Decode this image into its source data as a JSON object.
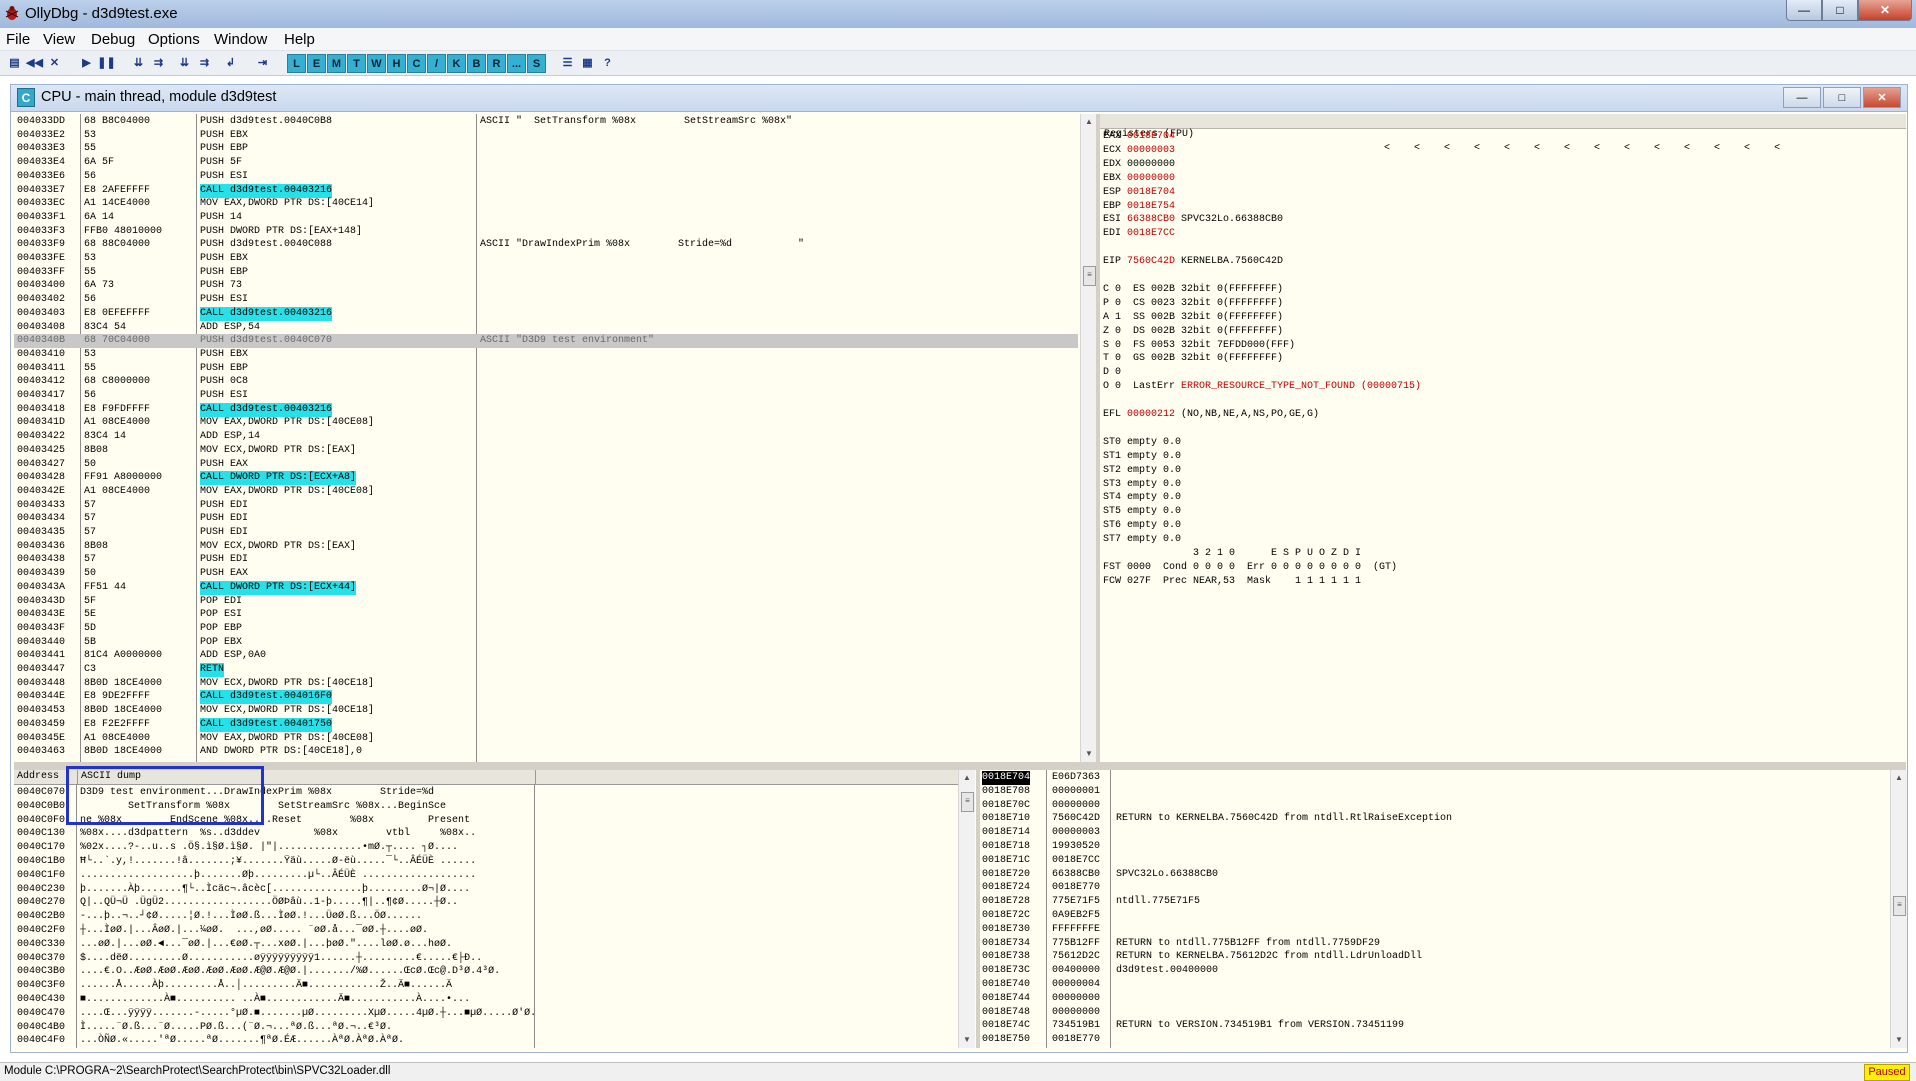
{
  "window": {
    "title": "OllyDbg - d3d9test.exe",
    "minimize": "—",
    "maximize": "□",
    "close": "✕"
  },
  "menu": [
    "File",
    "View",
    "Debug",
    "Options",
    "Window",
    "Help"
  ],
  "toolbar": {
    "letters": [
      "L",
      "E",
      "M",
      "T",
      "W",
      "H",
      "C",
      "/",
      "K",
      "B",
      "R",
      "...",
      "S"
    ],
    "icons": [
      "open-icon",
      "rewind-icon",
      "close-icon",
      "run-icon",
      "pause-icon",
      "step-into-icon",
      "step-over-icon",
      "trace-into-icon",
      "trace-over-icon",
      "execute-till-return-icon",
      "goto-icon"
    ],
    "help": "?"
  },
  "cpu_window": {
    "badge": "C",
    "title": "CPU - main thread, module d3d9test"
  },
  "disasm": {
    "rows": [
      {
        "addr": "004033DD",
        "hex": "68 B8C04000",
        "asm": "PUSH d3d9test.0040C0B8",
        "cmt": "ASCII \"  SetTransform %08x        SetStreamSrc %08x\""
      },
      {
        "addr": "004033E2",
        "hex": "53",
        "asm": "PUSH EBX",
        "cmt": ""
      },
      {
        "addr": "004033E3",
        "hex": "55",
        "asm": "PUSH EBP",
        "cmt": ""
      },
      {
        "addr": "004033E4",
        "hex": "6A 5F",
        "asm": "PUSH 5F",
        "cmt": ""
      },
      {
        "addr": "004033E6",
        "hex": "56",
        "asm": "PUSH ESI",
        "cmt": ""
      },
      {
        "addr": "004033E7",
        "hex": "E8 2AFEFFFF",
        "asm": "CALL d3d9test.00403216",
        "cmt": "",
        "call": true
      },
      {
        "addr": "004033EC",
        "hex": "A1 14CE4000",
        "asm": "MOV EAX,DWORD PTR DS:[40CE14]",
        "cmt": ""
      },
      {
        "addr": "004033F1",
        "hex": "6A 14",
        "asm": "PUSH 14",
        "cmt": ""
      },
      {
        "addr": "004033F3",
        "hex": "FFB0 48010000",
        "asm": "PUSH DWORD PTR DS:[EAX+148]",
        "cmt": ""
      },
      {
        "addr": "004033F9",
        "hex": "68 88C04000",
        "asm": "PUSH d3d9test.0040C088",
        "cmt": "ASCII \"DrawIndexPrim %08x        Stride=%d           \""
      },
      {
        "addr": "004033FE",
        "hex": "53",
        "asm": "PUSH EBX",
        "cmt": ""
      },
      {
        "addr": "004033FF",
        "hex": "55",
        "asm": "PUSH EBP",
        "cmt": ""
      },
      {
        "addr": "00403400",
        "hex": "6A 73",
        "asm": "PUSH 73",
        "cmt": ""
      },
      {
        "addr": "00403402",
        "hex": "56",
        "asm": "PUSH ESI",
        "cmt": ""
      },
      {
        "addr": "00403403",
        "hex": "E8 0EFEFFFF",
        "asm": "CALL d3d9test.00403216",
        "cmt": "",
        "call": true
      },
      {
        "addr": "00403408",
        "hex": "83C4 54",
        "asm": "ADD ESP,54",
        "cmt": ""
      },
      {
        "addr": "0040340B",
        "hex": "68 70C04000",
        "asm": "PUSH d3d9test.0040C070",
        "cmt": "ASCII \"D3D9 test environment\"",
        "sel": true
      },
      {
        "addr": "00403410",
        "hex": "53",
        "asm": "PUSH EBX",
        "cmt": ""
      },
      {
        "addr": "00403411",
        "hex": "55",
        "asm": "PUSH EBP",
        "cmt": ""
      },
      {
        "addr": "00403412",
        "hex": "68 C8000000",
        "asm": "PUSH 0C8",
        "cmt": ""
      },
      {
        "addr": "00403417",
        "hex": "56",
        "asm": "PUSH ESI",
        "cmt": ""
      },
      {
        "addr": "00403418",
        "hex": "E8 F9FDFFFF",
        "asm": "CALL d3d9test.00403216",
        "cmt": "",
        "call": true
      },
      {
        "addr": "0040341D",
        "hex": "A1 08CE4000",
        "asm": "MOV EAX,DWORD PTR DS:[40CE08]",
        "cmt": ""
      },
      {
        "addr": "00403422",
        "hex": "83C4 14",
        "asm": "ADD ESP,14",
        "cmt": ""
      },
      {
        "addr": "00403425",
        "hex": "8B08",
        "asm": "MOV ECX,DWORD PTR DS:[EAX]",
        "cmt": ""
      },
      {
        "addr": "00403427",
        "hex": "50",
        "asm": "PUSH EAX",
        "cmt": ""
      },
      {
        "addr": "00403428",
        "hex": "FF91 A8000000",
        "asm": "CALL DWORD PTR DS:[ECX+A8]",
        "cmt": "",
        "call": true
      },
      {
        "addr": "0040342E",
        "hex": "A1 08CE4000",
        "asm": "MOV EAX,DWORD PTR DS:[40CE08]",
        "cmt": ""
      },
      {
        "addr": "00403433",
        "hex": "57",
        "asm": "PUSH EDI",
        "cmt": ""
      },
      {
        "addr": "00403434",
        "hex": "57",
        "asm": "PUSH EDI",
        "cmt": ""
      },
      {
        "addr": "00403435",
        "hex": "57",
        "asm": "PUSH EDI",
        "cmt": ""
      },
      {
        "addr": "00403436",
        "hex": "8B08",
        "asm": "MOV ECX,DWORD PTR DS:[EAX]",
        "cmt": ""
      },
      {
        "addr": "00403438",
        "hex": "57",
        "asm": "PUSH EDI",
        "cmt": ""
      },
      {
        "addr": "00403439",
        "hex": "50",
        "asm": "PUSH EAX",
        "cmt": ""
      },
      {
        "addr": "0040343A",
        "hex": "FF51 44",
        "asm": "CALL DWORD PTR DS:[ECX+44]",
        "cmt": "",
        "call": true
      },
      {
        "addr": "0040343D",
        "hex": "5F",
        "asm": "POP EDI",
        "cmt": ""
      },
      {
        "addr": "0040343E",
        "hex": "5E",
        "asm": "POP ESI",
        "cmt": ""
      },
      {
        "addr": "0040343F",
        "hex": "5D",
        "asm": "POP EBP",
        "cmt": ""
      },
      {
        "addr": "00403440",
        "hex": "5B",
        "asm": "POP EBX",
        "cmt": ""
      },
      {
        "addr": "00403441",
        "hex": "81C4 A0000000",
        "asm": "ADD ESP,0A0",
        "cmt": ""
      },
      {
        "addr": "00403447",
        "hex": "C3",
        "asm": "RETN",
        "cmt": "",
        "call": true
      },
      {
        "addr": "00403448",
        "hex": "8B0D 18CE4000",
        "asm": "MOV ECX,DWORD PTR DS:[40CE18]",
        "cmt": ""
      },
      {
        "addr": "0040344E",
        "hex": "E8 9DE2FFFF",
        "asm": "CALL d3d9test.004016F0",
        "cmt": "",
        "call": true
      },
      {
        "addr": "00403453",
        "hex": "8B0D 18CE4000",
        "asm": "MOV ECX,DWORD PTR DS:[40CE18]",
        "cmt": ""
      },
      {
        "addr": "00403459",
        "hex": "E8 F2E2FFFF",
        "asm": "CALL d3d9test.00401750",
        "cmt": "",
        "call": true
      },
      {
        "addr": "0040345E",
        "hex": "A1 08CE4000",
        "asm": "MOV EAX,DWORD PTR DS:[40CE08]",
        "cmt": ""
      },
      {
        "addr": "00403463",
        "hex": "8B0D 18CE4000",
        "asm": "AND DWORD PTR DS:[40CE18],0",
        "cmt": ""
      }
    ]
  },
  "registers": {
    "header": "Registers (FPU)",
    "header_arrows": "<    <    <    <    <    <    <    <    <    <    <    <    <    <",
    "lines": [
      {
        "name": "EAX ",
        "value": "0018E704",
        "note": "",
        "red": true
      },
      {
        "name": "ECX ",
        "value": "00000003",
        "note": "",
        "red": true
      },
      {
        "name": "EDX ",
        "value": "00000000",
        "note": "",
        "red": false
      },
      {
        "name": "EBX ",
        "value": "00000000",
        "note": "",
        "red": true
      },
      {
        "name": "ESP ",
        "value": "0018E704",
        "note": "",
        "red": true
      },
      {
        "name": "EBP ",
        "value": "0018E754",
        "note": "",
        "red": true
      },
      {
        "name": "ESI ",
        "value": "66388CB0",
        "note": " SPVC32Lo.66388CB0",
        "red": true
      },
      {
        "name": "EDI ",
        "value": "0018E7CC",
        "note": "",
        "red": true
      },
      {
        "name": "",
        "value": "",
        "note": "",
        "red": false
      },
      {
        "name": "EIP ",
        "value": "7560C42D",
        "note": " KERNELBA.7560C42D",
        "red": true
      },
      {
        "name": "",
        "value": "",
        "note": "",
        "red": false
      },
      {
        "name": "C 0  ES 002B 32bit 0(FFFFFFFF)",
        "value": "",
        "note": "",
        "red": false
      },
      {
        "name": "P 0  CS 0023 32bit 0(FFFFFFFF)",
        "value": "",
        "note": "",
        "red": false
      },
      {
        "name": "A 1  SS 002B 32bit 0(FFFFFFFF)",
        "value": "",
        "note": "",
        "red": false
      },
      {
        "name": "Z 0  DS 002B 32bit 0(FFFFFFFF)",
        "value": "",
        "note": "",
        "red": false
      },
      {
        "name": "S 0  FS 0053 32bit 7EFDD000(FFF)",
        "value": "",
        "note": "",
        "red": false
      },
      {
        "name": "T 0  GS 002B 32bit 0(FFFFFFFF)",
        "value": "",
        "note": "",
        "red": false
      },
      {
        "name": "D 0",
        "value": "",
        "note": "",
        "red": false
      },
      {
        "name": "O 0  LastErr ",
        "value": "ERROR_RESOURCE_TYPE_NOT_FOUND (00000715)",
        "note": "",
        "red": true
      },
      {
        "name": "",
        "value": "",
        "note": "",
        "red": false
      },
      {
        "name": "EFL ",
        "value": "00000212",
        "note": " (NO,NB,NE,A,NS,PO,GE,G)",
        "red": true
      },
      {
        "name": "",
        "value": "",
        "note": "",
        "red": false
      },
      {
        "name": "ST0 empty 0.0",
        "value": "",
        "note": "",
        "red": false
      },
      {
        "name": "ST1 empty 0.0",
        "value": "",
        "note": "",
        "red": false
      },
      {
        "name": "ST2 empty 0.0",
        "value": "",
        "note": "",
        "red": false
      },
      {
        "name": "ST3 empty 0.0",
        "value": "",
        "note": "",
        "red": false
      },
      {
        "name": "ST4 empty 0.0",
        "value": "",
        "note": "",
        "red": false
      },
      {
        "name": "ST5 empty 0.0",
        "value": "",
        "note": "",
        "red": false
      },
      {
        "name": "ST6 empty 0.0",
        "value": "",
        "note": "",
        "red": false
      },
      {
        "name": "ST7 empty 0.0",
        "value": "",
        "note": "",
        "red": false
      },
      {
        "name": "               3 2 1 0      E S P U O Z D I",
        "value": "",
        "note": "",
        "red": false
      },
      {
        "name": "FST 0000  Cond 0 0 0 0  Err 0 0 0 0 0 0 0 0  (GT)",
        "value": "",
        "note": "",
        "red": false
      },
      {
        "name": "FCW 027F  Prec NEAR,53  Mask    1 1 1 1 1 1",
        "value": "",
        "note": "",
        "red": false
      }
    ]
  },
  "dump": {
    "header_address": "Address",
    "header_ascii": "ASCII dump",
    "rows": [
      {
        "addr": "0040C070",
        "ascii": "D3D9 test environment...DrawIndexPrim %08x        Stride=%d"
      },
      {
        "addr": "0040C0B0",
        "ascii": "        SetTransform %08x        SetStreamSrc %08x...BeginSce"
      },
      {
        "addr": "0040C0F0",
        "ascii": "ne %08x        EndScene %08x....Reset        %08x         Present"
      },
      {
        "addr": "0040C130",
        "ascii": "%08x....d3dpattern  %s..d3ddev         %08x        vtbl     %08x.."
      },
      {
        "addr": "0040C170",
        "ascii": "%02x....?-..u..s .Ö§.ì§Ø.ì§Ø. |\"|..............•mØ.┬.... ┐Ø...."
      },
      {
        "addr": "0040C1B0",
        "ascii": "Ħ└..`.y,!.......!â.......;¥.......Ÿäù.....Ø-ëù.....¯└..ÂÉÜÈ ......"
      },
      {
        "addr": "0040C1F0",
        "ascii": "...................þ.......Øþ.........µ└..ÂÉÜÈ ..................."
      },
      {
        "addr": "0040C230",
        "ascii": "þ.......Àþ.......¶└..Ìcäc¬.âcèc[...............þ.........Ø¬|Ø...."
      },
      {
        "addr": "0040C270",
        "ascii": "Q|..QÜ¬Ü .ÜgÜ2..................ÖØÞâù..1-þ.....¶|..¶¢Ø.....┼Ø.."
      },
      {
        "addr": "0040C2B0",
        "ascii": "-...þ..¬..┘¢Ø.....¦Ø.!...ÌøØ.ß...ÌøØ.!...ÜøØ.ß...ÖØ......"
      },
      {
        "addr": "0040C2F0",
        "ascii": "┼...ÌøØ.|...ÂøØ.|...¼øØ.  ...,øØ..... ¨øØ.å...¯øØ.┼....øØ."
      },
      {
        "addr": "0040C330",
        "ascii": "...øØ.|...øØ.◄...¯øØ.|...€øØ.┬...xøØ.|...þøØ.\"....løØ.ø...høØ."
      },
      {
        "addr": "0040C370",
        "ascii": "$....dëØ.........Ø...........øÿÿÿÿÿÿÿÿÿ1......┼.........€.....€├Ð.."
      },
      {
        "addr": "0040C3B0",
        "ascii": "....€.O..ÆøØ.ÆøØ.ÆøØ.ÆøØ.ÆøØ.Æ@Ø.Æ@Ø.|......./%Ø......ŒcØ.Œc@.D³Ø.4³Ø."
      },
      {
        "addr": "0040C3F0",
        "ascii": "......Å.....Àþ.........Å..│.........Ä■............Ž..Ä■......Ä"
      },
      {
        "addr": "0040C430",
        "ascii": "■.............À■.......... ..À■............Ä■...........À....•... "
      },
      {
        "addr": "0040C470",
        "ascii": "....Œ...ÿÿÿÿ.......-.....°µØ.■.......µØ.........XµØ.....4µØ.┼...■µØ.....Ø'Ø."
      },
      {
        "addr": "0040C4B0",
        "ascii": "Ì.....¨Ø.ß...¨Ø.....PØ.ß...(¨Ø.¬...ªØ.ß...ªØ.¬..€³Ø."
      },
      {
        "addr": "0040C4F0",
        "ascii": "...ÒÑØ.«.....'ªØ.....ªØ.......¶ªØ.ÉÆ......ÀªØ.ÀªØ.ÀªØ."
      }
    ]
  },
  "stack": {
    "rows": [
      {
        "addr": "0018E704",
        "val": "E06D7363",
        "cmt": "",
        "top": true
      },
      {
        "addr": "0018E708",
        "val": "00000001",
        "cmt": ""
      },
      {
        "addr": "0018E70C",
        "val": "00000000",
        "cmt": ""
      },
      {
        "addr": "0018E710",
        "val": "7560C42D",
        "cmt": "RETURN to KERNELBA.7560C42D from ntdll.RtlRaiseException"
      },
      {
        "addr": "0018E714",
        "val": "00000003",
        "cmt": ""
      },
      {
        "addr": "0018E718",
        "val": "19930520",
        "cmt": ""
      },
      {
        "addr": "0018E71C",
        "val": "0018E7CC",
        "cmt": ""
      },
      {
        "addr": "0018E720",
        "val": "66388CB0",
        "cmt": "SPVC32Lo.66388CB0"
      },
      {
        "addr": "0018E724",
        "val": "0018E770",
        "cmt": ""
      },
      {
        "addr": "0018E728",
        "val": "775E71F5",
        "cmt": "ntdll.775E71F5"
      },
      {
        "addr": "0018E72C",
        "val": "0A9EB2F5",
        "cmt": ""
      },
      {
        "addr": "0018E730",
        "val": "FFFFFFFE",
        "cmt": ""
      },
      {
        "addr": "0018E734",
        "val": "775B12FF",
        "cmt": "RETURN to ntdll.775B12FF from ntdll.7759DF29"
      },
      {
        "addr": "0018E738",
        "val": "75612D2C",
        "cmt": "RETURN to KERNELBA.75612D2C from ntdll.LdrUnloadDll"
      },
      {
        "addr": "0018E73C",
        "val": "00400000",
        "cmt": "d3d9test.00400000"
      },
      {
        "addr": "0018E740",
        "val": "00000004",
        "cmt": ""
      },
      {
        "addr": "0018E744",
        "val": "00000000",
        "cmt": ""
      },
      {
        "addr": "0018E748",
        "val": "00000000",
        "cmt": ""
      },
      {
        "addr": "0018E74C",
        "val": "734519B1",
        "cmt": "RETURN to VERSION.734519B1 from VERSION.73451199"
      },
      {
        "addr": "0018E750",
        "val": "0018E770",
        "cmt": ""
      }
    ]
  },
  "status": {
    "text": "Module C:\\PROGRA~2\\SearchProtect\\SearchProtect\\bin\\SPVC32Loader.dll",
    "state": "Paused"
  }
}
